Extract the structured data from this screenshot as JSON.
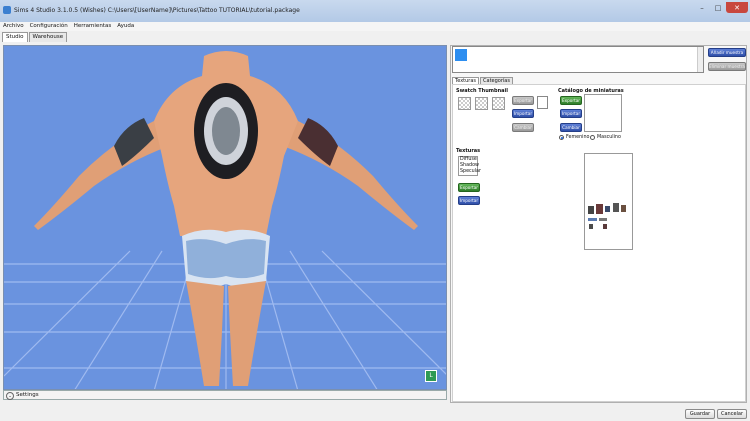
{
  "window": {
    "title": "Sims 4 Studio 3.1.0.5 (Wishes)  C:\\Users\\[UserName]\\Pictures\\Tattoo TUTORIAL\\tutorial.package"
  },
  "menu": [
    "Archivo",
    "Configuración",
    "Herramientas",
    "Ayuda"
  ],
  "tabs": [
    "Studio",
    "Warehouse"
  ],
  "viewport": {
    "settings_label": "Settings",
    "background_color": "#6a93df",
    "corner_badge": "L"
  },
  "swatches": {
    "add_button": "Añadir muestra",
    "remove_button": "Eliminar muestra"
  },
  "subtabs": [
    "Texturas",
    "Categorías"
  ],
  "swatch_thumbnail": {
    "title": "Swatch Thumbnail",
    "export": "Exportar",
    "import": "Importar",
    "change": "Cambiar"
  },
  "catalog": {
    "title": "Catálogo de miniaturas",
    "export": "Exportar",
    "import": "Importar",
    "change": "Cambiar",
    "radio_female": "Femenino",
    "radio_male": "Masculino",
    "selected": "Femenino"
  },
  "textures": {
    "title": "Texturas",
    "list": [
      "Diffuse",
      "Shadow",
      "Specular"
    ],
    "export": "Exportar",
    "import": "Importar"
  },
  "footer": {
    "save": "Guardar",
    "cancel": "Cancelar"
  }
}
